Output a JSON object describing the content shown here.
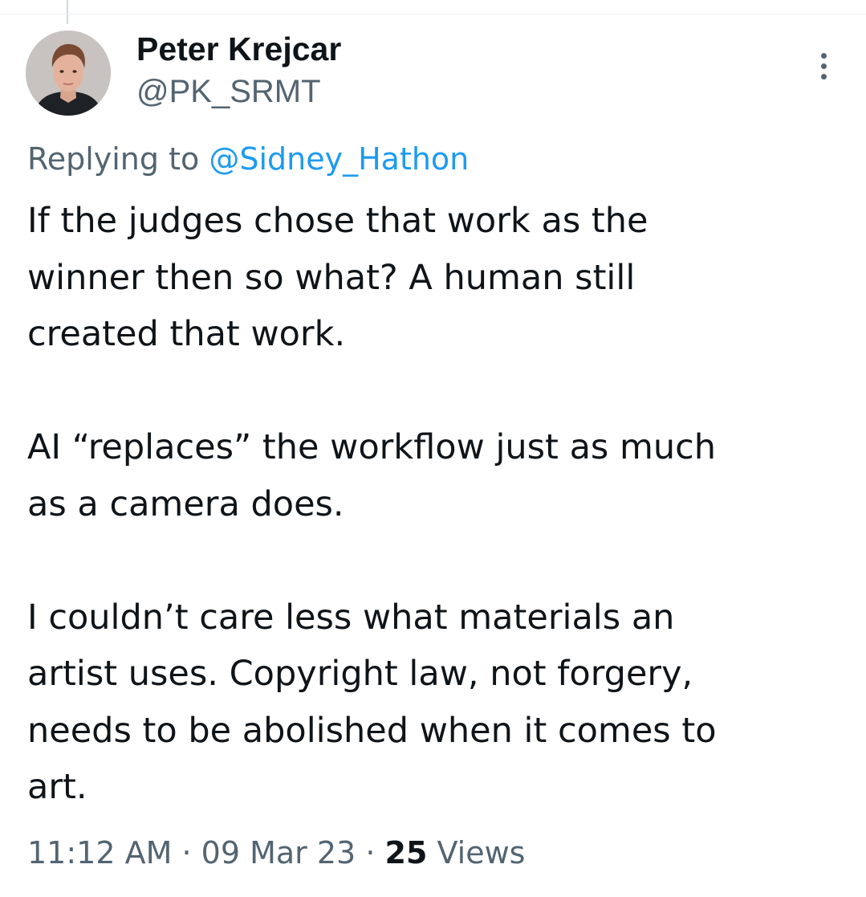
{
  "author": {
    "display_name": "Peter Krejcar",
    "handle": "@PK_SRMT"
  },
  "reply_context": {
    "prefix": "Replying to",
    "mention": "@Sidney_Hathon"
  },
  "tweet": {
    "paragraphs": [
      "If the judges chose that work as the\nwinner then so what? A human still\ncreated that work.",
      "AI “replaces” the workflow just as much\nas a camera does.",
      "I couldn’t care less what materials an\nartist uses. Copyright law, not forgery,\nneeds to be abolished when it comes to\nart."
    ]
  },
  "meta": {
    "time": "11:12 AM",
    "separator": "·",
    "date": "09 Mar 23",
    "views_count": "25",
    "views_label": "Views"
  },
  "icons": {
    "more": "more-options-icon",
    "avatar": "profile-photo"
  },
  "colors": {
    "text_primary": "#0f1419",
    "text_secondary": "#536471",
    "link": "#1d9bf0"
  }
}
